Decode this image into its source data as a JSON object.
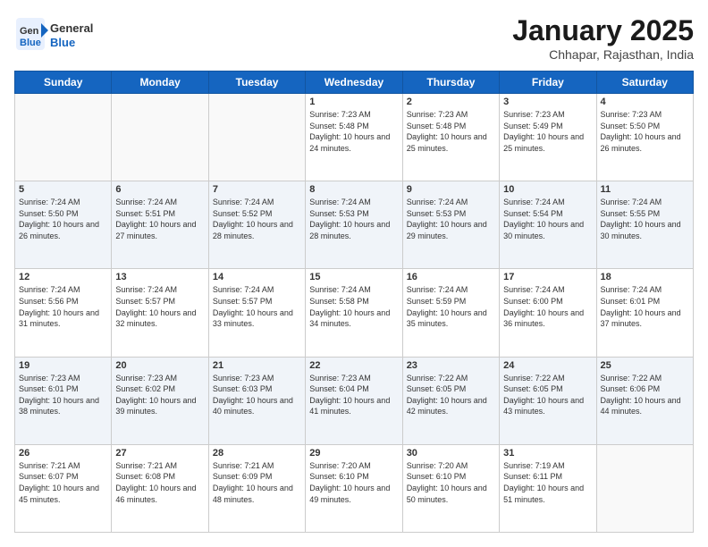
{
  "header": {
    "logo_text_general": "General",
    "logo_text_blue": "Blue",
    "month": "January 2025",
    "location": "Chhapar, Rajasthan, India"
  },
  "days_of_week": [
    "Sunday",
    "Monday",
    "Tuesday",
    "Wednesday",
    "Thursday",
    "Friday",
    "Saturday"
  ],
  "weeks": [
    [
      {
        "day": "",
        "empty": true
      },
      {
        "day": "",
        "empty": true
      },
      {
        "day": "",
        "empty": true
      },
      {
        "day": "1",
        "sunrise": "7:23 AM",
        "sunset": "5:48 PM",
        "daylight": "10 hours and 24 minutes."
      },
      {
        "day": "2",
        "sunrise": "7:23 AM",
        "sunset": "5:48 PM",
        "daylight": "10 hours and 25 minutes."
      },
      {
        "day": "3",
        "sunrise": "7:23 AM",
        "sunset": "5:49 PM",
        "daylight": "10 hours and 25 minutes."
      },
      {
        "day": "4",
        "sunrise": "7:23 AM",
        "sunset": "5:50 PM",
        "daylight": "10 hours and 26 minutes."
      }
    ],
    [
      {
        "day": "5",
        "sunrise": "7:24 AM",
        "sunset": "5:50 PM",
        "daylight": "10 hours and 26 minutes."
      },
      {
        "day": "6",
        "sunrise": "7:24 AM",
        "sunset": "5:51 PM",
        "daylight": "10 hours and 27 minutes."
      },
      {
        "day": "7",
        "sunrise": "7:24 AM",
        "sunset": "5:52 PM",
        "daylight": "10 hours and 28 minutes."
      },
      {
        "day": "8",
        "sunrise": "7:24 AM",
        "sunset": "5:53 PM",
        "daylight": "10 hours and 28 minutes."
      },
      {
        "day": "9",
        "sunrise": "7:24 AM",
        "sunset": "5:53 PM",
        "daylight": "10 hours and 29 minutes."
      },
      {
        "day": "10",
        "sunrise": "7:24 AM",
        "sunset": "5:54 PM",
        "daylight": "10 hours and 30 minutes."
      },
      {
        "day": "11",
        "sunrise": "7:24 AM",
        "sunset": "5:55 PM",
        "daylight": "10 hours and 30 minutes."
      }
    ],
    [
      {
        "day": "12",
        "sunrise": "7:24 AM",
        "sunset": "5:56 PM",
        "daylight": "10 hours and 31 minutes."
      },
      {
        "day": "13",
        "sunrise": "7:24 AM",
        "sunset": "5:57 PM",
        "daylight": "10 hours and 32 minutes."
      },
      {
        "day": "14",
        "sunrise": "7:24 AM",
        "sunset": "5:57 PM",
        "daylight": "10 hours and 33 minutes."
      },
      {
        "day": "15",
        "sunrise": "7:24 AM",
        "sunset": "5:58 PM",
        "daylight": "10 hours and 34 minutes."
      },
      {
        "day": "16",
        "sunrise": "7:24 AM",
        "sunset": "5:59 PM",
        "daylight": "10 hours and 35 minutes."
      },
      {
        "day": "17",
        "sunrise": "7:24 AM",
        "sunset": "6:00 PM",
        "daylight": "10 hours and 36 minutes."
      },
      {
        "day": "18",
        "sunrise": "7:24 AM",
        "sunset": "6:01 PM",
        "daylight": "10 hours and 37 minutes."
      }
    ],
    [
      {
        "day": "19",
        "sunrise": "7:23 AM",
        "sunset": "6:01 PM",
        "daylight": "10 hours and 38 minutes."
      },
      {
        "day": "20",
        "sunrise": "7:23 AM",
        "sunset": "6:02 PM",
        "daylight": "10 hours and 39 minutes."
      },
      {
        "day": "21",
        "sunrise": "7:23 AM",
        "sunset": "6:03 PM",
        "daylight": "10 hours and 40 minutes."
      },
      {
        "day": "22",
        "sunrise": "7:23 AM",
        "sunset": "6:04 PM",
        "daylight": "10 hours and 41 minutes."
      },
      {
        "day": "23",
        "sunrise": "7:22 AM",
        "sunset": "6:05 PM",
        "daylight": "10 hours and 42 minutes."
      },
      {
        "day": "24",
        "sunrise": "7:22 AM",
        "sunset": "6:05 PM",
        "daylight": "10 hours and 43 minutes."
      },
      {
        "day": "25",
        "sunrise": "7:22 AM",
        "sunset": "6:06 PM",
        "daylight": "10 hours and 44 minutes."
      }
    ],
    [
      {
        "day": "26",
        "sunrise": "7:21 AM",
        "sunset": "6:07 PM",
        "daylight": "10 hours and 45 minutes."
      },
      {
        "day": "27",
        "sunrise": "7:21 AM",
        "sunset": "6:08 PM",
        "daylight": "10 hours and 46 minutes."
      },
      {
        "day": "28",
        "sunrise": "7:21 AM",
        "sunset": "6:09 PM",
        "daylight": "10 hours and 48 minutes."
      },
      {
        "day": "29",
        "sunrise": "7:20 AM",
        "sunset": "6:10 PM",
        "daylight": "10 hours and 49 minutes."
      },
      {
        "day": "30",
        "sunrise": "7:20 AM",
        "sunset": "6:10 PM",
        "daylight": "10 hours and 50 minutes."
      },
      {
        "day": "31",
        "sunrise": "7:19 AM",
        "sunset": "6:11 PM",
        "daylight": "10 hours and 51 minutes."
      },
      {
        "day": "",
        "empty": true
      }
    ]
  ]
}
